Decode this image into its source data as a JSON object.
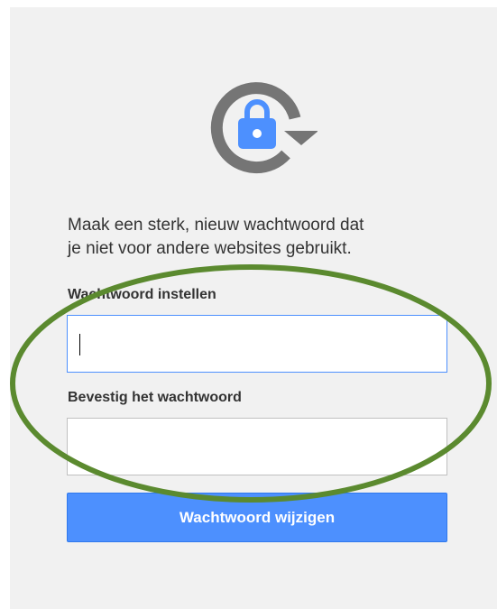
{
  "intro": {
    "line1": "Maak een sterk, nieuw wachtwoord dat",
    "line2": "je niet voor andere websites gebruikt."
  },
  "form": {
    "new_password_label": "Wachtwoord instellen",
    "new_password_value": "",
    "confirm_password_label": "Bevestig het wachtwoord",
    "confirm_password_value": "",
    "submit_label": "Wachtwoord wijzigen"
  },
  "icons": {
    "logo": "lock-refresh-icon"
  },
  "colors": {
    "card_background": "#f1f1f1",
    "accent_blue": "#4d90fe",
    "logo_gray": "#757575",
    "annotation_green": "#5b8a2f",
    "text": "#333333"
  }
}
